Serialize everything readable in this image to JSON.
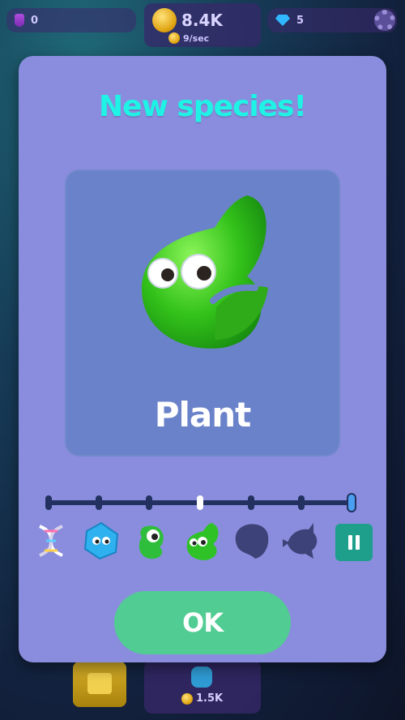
{
  "hud": {
    "dna_count": "0",
    "coins": "8.4K",
    "coin_rate": "9/sec",
    "gems": "5",
    "icons": {
      "dna": "vial-icon",
      "coin": "coin-icon",
      "gem": "gem-icon",
      "settings": "gear-icon"
    }
  },
  "modal": {
    "title": "New species!",
    "species_name": "Plant",
    "ok_label": "OK",
    "evolution_stages": [
      {
        "name": "dna-icon",
        "unlocked": true
      },
      {
        "name": "blue-blob-icon",
        "unlocked": true
      },
      {
        "name": "green-worm-icon",
        "unlocked": true
      },
      {
        "name": "plant-icon",
        "unlocked": true,
        "current": true
      },
      {
        "name": "locked-silhouette-1-icon",
        "unlocked": false
      },
      {
        "name": "locked-fish-silhouette-icon",
        "unlocked": false
      }
    ],
    "timeline_progress": "4 of 7",
    "colors": {
      "title": "#1ff3e6",
      "panel": "#8a8ddd",
      "ok": "#51cc93"
    }
  },
  "bottom": {
    "price": "1.5K"
  }
}
